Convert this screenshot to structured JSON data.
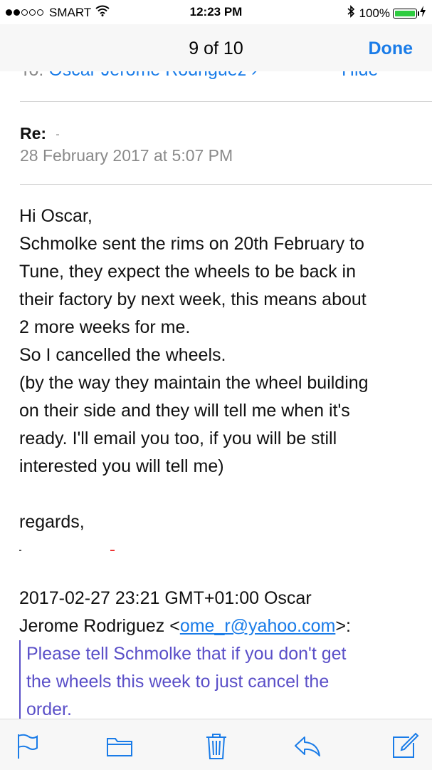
{
  "status_bar": {
    "carrier": "SMART",
    "time": "12:23 PM",
    "battery": "100%",
    "signal_bars_full": 2,
    "signal_bars_total": 5,
    "battery_level": 1.0
  },
  "nav": {
    "title": "9 of 10",
    "done_label": "Done"
  },
  "header": {
    "to_label": "To:",
    "to_name": "Oscar Jerome Rodriguez",
    "hide_label": "Hide",
    "subject_prefix": "Re:",
    "date": "28 February 2017 at 5:07 PM"
  },
  "body": {
    "lines": [
      "Hi Oscar,",
      "Schmolke sent the rims on 20th February to",
      "Tune, they expect the wheels to be back in",
      "their factory by next week, this means about",
      "2 more weeks for me.",
      "So I cancelled the wheels.",
      "(by the way they maintain the wheel building",
      "on their side and they will tell me when it's",
      "ready. I'll email you too, if you will be still",
      "interested you will tell me)",
      "",
      "regards,"
    ]
  },
  "quoted": {
    "attrib_line1": "2017-02-27 23:21 GMT+01:00 Oscar",
    "attrib_line2_prefix": "Jerome Rodriguez <",
    "email": "ome_r@yahoo.com",
    "attrib_line2_suffix": ">:",
    "lines": [
      "Please tell Schmolke that if you don't get",
      "the wheels this week to just cancel the",
      "order."
    ]
  },
  "toolbar": {
    "icons": [
      "flag-icon",
      "folder-icon",
      "trash-icon",
      "reply-icon",
      "compose-icon"
    ]
  },
  "colors": {
    "accent": "#1a7ce8",
    "quote": "#5a4fc8",
    "battery": "#2ecc40"
  }
}
